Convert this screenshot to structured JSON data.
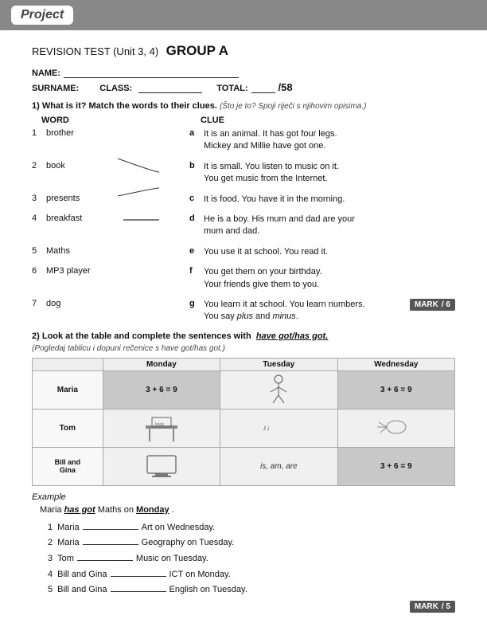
{
  "header": {
    "logo": "Project"
  },
  "page": {
    "title_prefix": "REVISION TEST (Unit 3, 4)",
    "title_main": "GROUP A",
    "name_label": "NAME:",
    "surname_label": "SURNAME:",
    "class_label": "CLASS:",
    "total_label": "TOTAL:",
    "total_value": "/58"
  },
  "section1": {
    "number": "1)",
    "instruction_en": "What is it? Match the words to their clues.",
    "instruction_cr": "(Što je to? Spoji riječi s njihovim opisima.)",
    "word_header": "WORD",
    "clue_header": "CLUE",
    "words": [
      {
        "num": "1",
        "word": "brother",
        "letter": "a",
        "clue": "It is an animal. It has got four legs.\nMickey and Millie have got one."
      },
      {
        "num": "2",
        "word": "book",
        "letter": "b",
        "clue": "It is small. You listen to music on it.\nYou get music from the Internet."
      },
      {
        "num": "3",
        "word": "presents",
        "letter": "c",
        "clue": "It is food. You have it in the morning."
      },
      {
        "num": "4",
        "word": "breakfast",
        "letter": "d",
        "clue": "He is a boy. His mum and dad are your\nmum and dad."
      },
      {
        "num": "5",
        "word": "Maths",
        "letter": "e",
        "clue": "You use it at school. You read it."
      },
      {
        "num": "6",
        "word": "MP3 player",
        "letter": "f",
        "clue": "You get them on your birthday.\nYour friends give them to you."
      },
      {
        "num": "7",
        "word": "dog",
        "letter": "g",
        "clue": "You learn it at school. You learn numbers.\nYou say plus and minus."
      }
    ],
    "mark_label": "MARK",
    "mark_value": "/ 6"
  },
  "section2": {
    "number": "2)",
    "instruction_en": "Look at the table and complete the sentences with",
    "highlight": "have got/has got.",
    "instruction_cr": "(Pogledaj tablicu i dopuni rečenice s have got/has got.)",
    "table": {
      "headers": [
        "",
        "Monday",
        "Tuesday",
        "Wednesday"
      ],
      "rows": [
        {
          "name": "Maria",
          "mon": "math",
          "tue": "picture",
          "wed": "math"
        },
        {
          "name": "Tom",
          "mon": "picture",
          "tue": "music",
          "wed": "picture"
        },
        {
          "name": "Bill and\nGina",
          "mon": "picture",
          "tue": "is, am, are",
          "wed": "math"
        }
      ]
    },
    "example_label": "Example",
    "example_text": "Maria has got Maths on Monday .",
    "sentences": [
      {
        "num": "1",
        "text_before": "Maria",
        "blank": true,
        "text_after": "Art on Wednesday."
      },
      {
        "num": "2",
        "text_before": "Maria",
        "blank": true,
        "text_after": "Geography on Tuesday."
      },
      {
        "num": "3",
        "text_before": "Tom",
        "blank": true,
        "text_after": "Music on Tuesday."
      },
      {
        "num": "4",
        "text_before": "Bill and Gina",
        "blank": true,
        "text_after": "ICT on Monday."
      },
      {
        "num": "5",
        "text_before": "Bill and Gina",
        "blank": true,
        "text_after": "English on Tuesday."
      }
    ],
    "mark_label": "MARK",
    "mark_value": "/ 5"
  }
}
